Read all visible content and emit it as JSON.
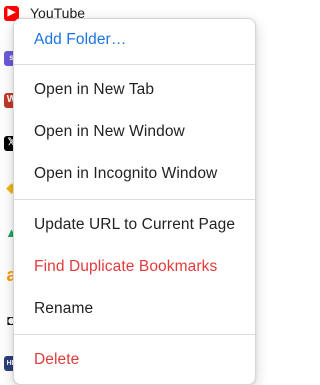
{
  "background_bookmarks": [
    {
      "icon": "youtube-icon",
      "color": "#ff0000",
      "glyph": "▶",
      "label": "YouTube"
    },
    {
      "icon": "purple-square-icon",
      "color": "#6b5bd6",
      "glyph": "s",
      "label": ""
    },
    {
      "icon": "game-logo-icon",
      "color": "#c0392b",
      "glyph": "W",
      "label": ""
    },
    {
      "icon": "x-icon",
      "color": "#000000",
      "glyph": "𝕏",
      "label": ""
    },
    {
      "icon": "binance-icon",
      "color": "#f0b90b",
      "glyph": "◆",
      "label": ""
    },
    {
      "icon": "google-drive-icon",
      "color": "#1fa463",
      "glyph": "▲",
      "label": ""
    },
    {
      "icon": "amazon-icon",
      "color": "#ff9900",
      "glyph": "a",
      "label": ""
    },
    {
      "icon": "shield-logo-icon",
      "color": "#111111",
      "glyph": "◘",
      "label": ""
    },
    {
      "icon": "hp-game-icon",
      "color": "#2c3e7a",
      "glyph": "HP",
      "label": ""
    }
  ],
  "context_menu": {
    "items": [
      {
        "label": "Add Folder…",
        "style": "blue"
      },
      {
        "label": "Open in New Tab",
        "style": "normal"
      },
      {
        "label": "Open in New Window",
        "style": "normal"
      },
      {
        "label": "Open in Incognito Window",
        "style": "normal"
      },
      {
        "label": "Update URL to Current Page",
        "style": "normal"
      },
      {
        "label": "Find Duplicate Bookmarks",
        "style": "red"
      },
      {
        "label": "Rename",
        "style": "normal"
      },
      {
        "label": "Delete",
        "style": "red"
      }
    ]
  },
  "colors": {
    "accent_blue": "#1a73e8",
    "danger_red": "#e23b3b"
  }
}
